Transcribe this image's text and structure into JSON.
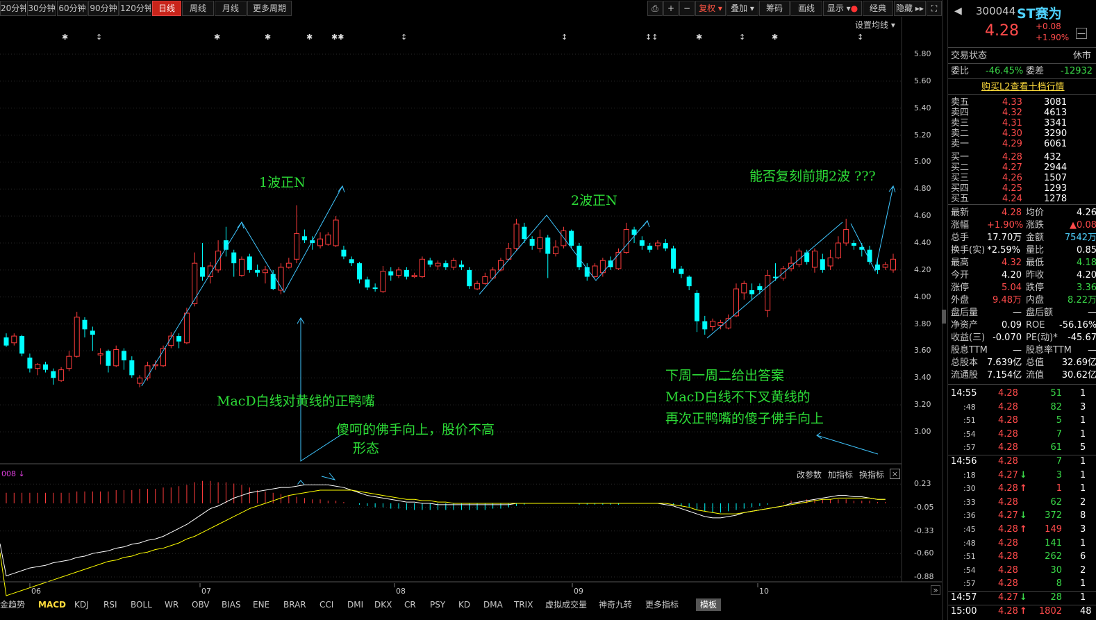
{
  "periods": [
    "20分钟",
    "30分钟",
    "60分钟",
    "90分钟",
    "120分钟",
    "日线",
    "周线",
    "月线",
    "更多周期"
  ],
  "active_period": "日线",
  "tools": [
    "复权",
    "叠加",
    "筹码",
    "画线",
    "显示",
    "经典",
    "隐藏"
  ],
  "settings_label": "设置均线",
  "macd_buttons": [
    "改参数",
    "加指标",
    "换指标"
  ],
  "macd_value": "008",
  "ind_tabs": [
    "金趋势",
    "MACD",
    "KDJ",
    "RSI",
    "BOLL",
    "WR",
    "OBV",
    "BIAS",
    "ENE",
    "BRAR",
    "CCI",
    "DMI",
    "DKX",
    "CR",
    "PSY",
    "KD",
    "DMA",
    "TRIX",
    "虚拟成交量",
    "神奇九转",
    "更多指标",
    "模板"
  ],
  "active_tab": "MACD",
  "price_axis": [
    "5.80",
    "5.60",
    "5.40",
    "5.20",
    "5.00",
    "4.80",
    "4.60",
    "4.40",
    "4.20",
    "4.00",
    "3.80",
    "3.60",
    "3.40",
    "3.20",
    "3.00"
  ],
  "macd_axis": [
    "0.23",
    "-0.05",
    "-0.33",
    "-0.60",
    "-0.88"
  ],
  "months": [
    "06",
    "07",
    "08",
    "09",
    "10"
  ],
  "annotations": {
    "wave1": "1波正N",
    "wave2": "2波正N",
    "question": "能否复刻前期2波 ???",
    "macd_line": "MacD白线对黄线的正鸭嘴",
    "fo1": "傻呵的佛手向上，股价不高",
    "fo2": "形态",
    "ans1": "下周一周二给出答案",
    "ans2": "MacD白线不下叉黄线的",
    "ans3": "再次正鸭嘴的傻子佛手向上"
  },
  "stock": {
    "code": "300044",
    "name": "ST赛为",
    "price": "4.28",
    "change": "+0.08",
    "pct": "+1.90%"
  },
  "status": {
    "label": "交易状态",
    "value": "休市"
  },
  "ratio": {
    "wb_label": "委比",
    "wb": "-46.45%",
    "wc_label": "委差",
    "wc": "-12932"
  },
  "l2_link": "购买L2查看十档行情",
  "asks": [
    [
      "卖五",
      "4.33",
      "3081"
    ],
    [
      "卖四",
      "4.32",
      "4613"
    ],
    [
      "卖三",
      "4.31",
      "3341"
    ],
    [
      "卖二",
      "4.30",
      "3290"
    ],
    [
      "卖一",
      "4.29",
      "6061"
    ]
  ],
  "bids": [
    [
      "买一",
      "4.28",
      "432"
    ],
    [
      "买二",
      "4.27",
      "2944"
    ],
    [
      "买三",
      "4.26",
      "1507"
    ],
    [
      "买四",
      "4.25",
      "1293"
    ],
    [
      "买五",
      "4.24",
      "1278"
    ]
  ],
  "stats": [
    [
      "最新",
      "4.28",
      "均价",
      "4.26"
    ],
    [
      "涨幅",
      "+1.90%",
      "涨跌",
      "▲0.08"
    ],
    [
      "总手",
      "17.70万",
      "金额",
      "7542万"
    ],
    [
      "换手(实)",
      "*2.59%",
      "量比",
      "0.85"
    ],
    [
      "最高",
      "4.32",
      "最低",
      "4.18"
    ],
    [
      "今开",
      "4.20",
      "昨收",
      "4.20"
    ],
    [
      "涨停",
      "5.04",
      "跌停",
      "3.36"
    ],
    [
      "外盘",
      "9.48万",
      "内盘",
      "8.22万"
    ],
    [
      "盘后量",
      "—",
      "盘后额",
      "—"
    ],
    [
      "净资产",
      "0.09",
      "ROE",
      "-56.16%"
    ],
    [
      "收益(三)",
      "-0.070",
      "PE(动)*",
      "-45.67"
    ],
    [
      "股息TTM",
      "—",
      "股息率TTM",
      "—"
    ],
    [
      "总股本",
      "7.639亿",
      "总值",
      "32.69亿"
    ],
    [
      "流通股",
      "7.154亿",
      "流值",
      "30.62亿"
    ]
  ],
  "ticks": [
    [
      "14:55",
      "4.28",
      "51",
      "1",
      ""
    ],
    [
      ":48",
      "4.28",
      "82",
      "3",
      ""
    ],
    [
      ":51",
      "4.28",
      "5",
      "1",
      ""
    ],
    [
      ":54",
      "4.28",
      "7",
      "1",
      ""
    ],
    [
      ":57",
      "4.28",
      "61",
      "5",
      ""
    ],
    [
      "14:56",
      "4.28",
      "7",
      "1",
      ""
    ],
    [
      ":18",
      "4.27",
      "3",
      "1",
      "down"
    ],
    [
      ":30",
      "4.28",
      "1",
      "1",
      "up"
    ],
    [
      ":33",
      "4.28",
      "62",
      "2",
      ""
    ],
    [
      ":36",
      "4.27",
      "372",
      "8",
      "down"
    ],
    [
      ":45",
      "4.28",
      "149",
      "3",
      "up"
    ],
    [
      ":48",
      "4.28",
      "141",
      "1",
      ""
    ],
    [
      ":51",
      "4.28",
      "262",
      "6",
      ""
    ],
    [
      ":54",
      "4.28",
      "30",
      "2",
      ""
    ],
    [
      ":57",
      "4.28",
      "8",
      "1",
      ""
    ],
    [
      "14:57",
      "4.27",
      "28",
      "1",
      "down"
    ],
    [
      "15:00",
      "4.28",
      "1802",
      "48",
      "up"
    ]
  ],
  "chart_data": {
    "type": "candlestick",
    "ylim": [
      2.9,
      5.85
    ],
    "x_months": [
      "06",
      "07",
      "08",
      "09",
      "10"
    ],
    "candles": [
      [
        3.7,
        3.64,
        3.73,
        3.63
      ],
      [
        3.66,
        3.71,
        3.73,
        3.64
      ],
      [
        3.71,
        3.58,
        3.72,
        3.56
      ],
      [
        3.55,
        3.47,
        3.58,
        3.44
      ],
      [
        3.47,
        3.5,
        3.51,
        3.42
      ],
      [
        3.5,
        3.46,
        3.52,
        3.44
      ],
      [
        3.45,
        3.4,
        3.47,
        3.35
      ],
      [
        3.38,
        3.46,
        3.48,
        3.37
      ],
      [
        3.47,
        3.56,
        3.6,
        3.45
      ],
      [
        3.56,
        3.85,
        3.89,
        3.55
      ],
      [
        3.83,
        3.76,
        3.85,
        3.7
      ],
      [
        3.75,
        3.72,
        3.78,
        3.6
      ],
      [
        3.57,
        3.58,
        3.62,
        3.5
      ],
      [
        3.6,
        3.49,
        3.61,
        3.44
      ],
      [
        3.49,
        3.61,
        3.64,
        3.48
      ],
      [
        3.6,
        3.53,
        3.62,
        3.46
      ],
      [
        3.53,
        3.42,
        3.56,
        3.4
      ],
      [
        3.36,
        3.4,
        3.42,
        3.33
      ],
      [
        3.4,
        3.49,
        3.52,
        3.38
      ],
      [
        3.49,
        3.5,
        3.53,
        3.46
      ],
      [
        3.49,
        3.62,
        3.64,
        3.48
      ],
      [
        3.64,
        3.71,
        3.74,
        3.62
      ],
      [
        3.71,
        3.67,
        3.73,
        3.62
      ],
      [
        3.66,
        3.88,
        3.92,
        3.65
      ],
      [
        3.95,
        4.25,
        4.33,
        3.93
      ],
      [
        4.22,
        4.15,
        4.4,
        4.12
      ],
      [
        4.15,
        4.23,
        4.26,
        4.1
      ],
      [
        4.2,
        4.34,
        4.42,
        4.18
      ],
      [
        4.42,
        4.35,
        4.52,
        4.3
      ],
      [
        4.33,
        4.25,
        4.35,
        4.15
      ],
      [
        4.16,
        4.28,
        4.3,
        4.15
      ],
      [
        4.3,
        4.2,
        4.32,
        4.18
      ],
      [
        4.2,
        4.18,
        4.24,
        4.15
      ],
      [
        4.18,
        4.2,
        4.23,
        4.1
      ],
      [
        4.17,
        4.06,
        4.2,
        4.05
      ],
      [
        4.05,
        4.22,
        4.25,
        4.02
      ],
      [
        4.22,
        4.25,
        4.29,
        4.21
      ],
      [
        4.28,
        4.47,
        4.68,
        4.25
      ],
      [
        4.45,
        4.42,
        4.5,
        4.4
      ],
      [
        4.42,
        4.4,
        4.45,
        4.35
      ],
      [
        4.38,
        4.43,
        4.48,
        4.36
      ],
      [
        4.39,
        4.46,
        4.48,
        4.38
      ],
      [
        4.38,
        4.57,
        4.6,
        4.37
      ],
      [
        4.35,
        4.3,
        4.38,
        4.28
      ],
      [
        4.28,
        4.25,
        4.3,
        4.23
      ],
      [
        4.25,
        4.13,
        4.26,
        4.1
      ],
      [
        4.13,
        4.07,
        4.15,
        4.05
      ],
      [
        4.07,
        4.06,
        4.1,
        4.04
      ],
      [
        4.04,
        4.19,
        4.23,
        4.03
      ],
      [
        4.19,
        4.16,
        4.22,
        4.12
      ],
      [
        4.16,
        4.2,
        4.22,
        4.14
      ],
      [
        4.2,
        4.15,
        4.22,
        4.13
      ],
      [
        4.15,
        4.16,
        4.18,
        4.14
      ],
      [
        4.15,
        4.28,
        4.3,
        4.14
      ],
      [
        4.27,
        4.24,
        4.29,
        4.22
      ],
      [
        4.23,
        4.25,
        4.27,
        4.2
      ],
      [
        4.25,
        4.22,
        4.27,
        4.2
      ],
      [
        4.22,
        4.27,
        4.29,
        4.2
      ],
      [
        4.24,
        4.22,
        4.27,
        4.2
      ],
      [
        4.2,
        4.08,
        4.22,
        4.06
      ],
      [
        4.06,
        4.1,
        4.12,
        4.05
      ],
      [
        4.1,
        4.15,
        4.18,
        4.09
      ],
      [
        4.14,
        4.2,
        4.22,
        4.13
      ],
      [
        4.2,
        4.27,
        4.29,
        4.19
      ],
      [
        4.28,
        4.36,
        4.4,
        4.27
      ],
      [
        4.36,
        4.54,
        4.58,
        4.34
      ],
      [
        4.52,
        4.43,
        4.55,
        4.4
      ],
      [
        4.43,
        4.38,
        4.45,
        4.35
      ],
      [
        4.36,
        4.44,
        4.5,
        4.33
      ],
      [
        4.44,
        4.32,
        4.46,
        4.14
      ],
      [
        4.32,
        4.37,
        4.42,
        4.3
      ],
      [
        4.38,
        4.49,
        4.52,
        4.36
      ],
      [
        4.49,
        4.38,
        4.5,
        4.36
      ],
      [
        4.38,
        4.22,
        4.4,
        4.2
      ],
      [
        4.22,
        4.15,
        4.25,
        4.12
      ],
      [
        4.15,
        4.23,
        4.25,
        4.14
      ],
      [
        4.18,
        4.27,
        4.29,
        4.15
      ],
      [
        4.27,
        4.22,
        4.3,
        4.2
      ],
      [
        4.21,
        4.33,
        4.36,
        4.2
      ],
      [
        4.33,
        4.5,
        4.55,
        4.32
      ],
      [
        4.5,
        4.46,
        4.52,
        4.4
      ],
      [
        4.42,
        4.38,
        4.45,
        4.35
      ],
      [
        4.38,
        4.35,
        4.4,
        4.33
      ],
      [
        4.38,
        4.4,
        4.42,
        4.35
      ],
      [
        4.4,
        4.36,
        4.43,
        4.34
      ],
      [
        4.36,
        4.21,
        4.38,
        4.18
      ],
      [
        4.21,
        4.17,
        4.23,
        4.14
      ],
      [
        4.15,
        4.08,
        4.16,
        4.05
      ],
      [
        4.03,
        3.82,
        4.05,
        3.74
      ],
      [
        3.82,
        3.76,
        3.86,
        3.72
      ],
      [
        3.78,
        3.82,
        3.84,
        3.75
      ],
      [
        3.79,
        3.81,
        3.83,
        3.76
      ],
      [
        3.77,
        3.84,
        3.87,
        3.76
      ],
      [
        3.86,
        4.06,
        4.1,
        3.85
      ],
      [
        4.03,
        4.1,
        4.12,
        3.98
      ],
      [
        4.05,
        4.02,
        4.1,
        3.98
      ],
      [
        4.08,
        4.05,
        4.1,
        4.02
      ],
      [
        3.9,
        4.16,
        4.2,
        3.85
      ],
      [
        4.15,
        4.14,
        4.25,
        4.12
      ],
      [
        4.14,
        4.21,
        4.23,
        4.12
      ],
      [
        4.21,
        4.25,
        4.3,
        4.19
      ],
      [
        4.24,
        4.34,
        4.36,
        4.22
      ],
      [
        4.33,
        4.26,
        4.35,
        4.24
      ],
      [
        4.22,
        4.34,
        4.36,
        4.18
      ],
      [
        4.28,
        4.2,
        4.32,
        4.18
      ],
      [
        4.23,
        4.29,
        4.35,
        4.2
      ],
      [
        4.29,
        4.4,
        4.45,
        4.28
      ],
      [
        4.4,
        4.5,
        4.58,
        4.38
      ],
      [
        4.4,
        4.38,
        4.42,
        4.35
      ],
      [
        4.37,
        4.35,
        4.4,
        4.3
      ],
      [
        4.35,
        4.26,
        4.38,
        4.24
      ],
      [
        4.24,
        4.2,
        4.28,
        4.17
      ],
      [
        4.22,
        4.24,
        4.26,
        4.2
      ],
      [
        4.2,
        4.28,
        4.32,
        4.18
      ]
    ],
    "macd_range": [
      -0.9,
      0.3
    ],
    "macd_hist": [
      0.08,
      0.08,
      0.08,
      0.08,
      0.08,
      0.08,
      0.08,
      0.08,
      0.08,
      0.09,
      0.09,
      0.09,
      0.09,
      0.09,
      0.1,
      0.1,
      0.1,
      0.11,
      0.11,
      0.11,
      0.12,
      0.12,
      0.13,
      0.14,
      0.16,
      0.17,
      0.17,
      0.16,
      0.16,
      0.15,
      0.14,
      0.12,
      0.1,
      0.09,
      0.08,
      0.07,
      0.06,
      0.05,
      0.04,
      0.03,
      0.03,
      0.02,
      0.02,
      0.01,
      0.0,
      -0.01,
      -0.02,
      -0.03,
      -0.03,
      -0.04,
      -0.04,
      -0.05,
      -0.05,
      -0.05,
      -0.05,
      -0.05,
      -0.05,
      -0.05,
      -0.05,
      -0.05,
      -0.05,
      -0.05,
      -0.04,
      -0.04,
      -0.03,
      -0.02,
      -0.01,
      0.0,
      0.0,
      0.0,
      0.0,
      0.0,
      0.0,
      -0.01,
      -0.01,
      -0.01,
      -0.01,
      -0.01,
      -0.01,
      0.0,
      0.0,
      0.0,
      0.0,
      0.0,
      0.0,
      -0.01,
      -0.02,
      -0.03,
      -0.05,
      -0.06,
      -0.07,
      -0.07,
      -0.06,
      -0.05,
      -0.04,
      -0.03,
      -0.02,
      -0.01,
      0.0,
      0.01,
      0.02,
      0.02,
      0.03,
      0.03,
      0.03,
      0.03,
      0.03,
      0.03,
      0.02,
      0.02,
      0.02,
      0.01,
      0.01
    ],
    "macd_dif": [
      -0.55,
      -0.53,
      -0.51,
      -0.49,
      -0.48,
      -0.47,
      -0.45,
      -0.44,
      -0.43,
      -0.41,
      -0.4,
      -0.38,
      -0.37,
      -0.36,
      -0.34,
      -0.33,
      -0.31,
      -0.3,
      -0.28,
      -0.27,
      -0.25,
      -0.22,
      -0.19,
      -0.16,
      -0.12,
      -0.08,
      -0.04,
      -0.02,
      0.01,
      0.04,
      0.06,
      0.08,
      0.09,
      0.1,
      0.11,
      0.12,
      0.12,
      0.13,
      0.14,
      0.14,
      0.14,
      0.14,
      0.13,
      0.12,
      0.1,
      0.08,
      0.06,
      0.05,
      0.04,
      0.03,
      0.02,
      0.01,
      0.01,
      0.0,
      0.0,
      -0.01,
      -0.01,
      -0.01,
      -0.01,
      -0.01,
      -0.01,
      -0.01,
      -0.01,
      -0.01,
      -0.01,
      0.0,
      0.0,
      0.0,
      0.0,
      0.0,
      0.0,
      0.0,
      0.0,
      0.0,
      0.0,
      0.0,
      0.0,
      0.0,
      0.0,
      0.0,
      0.0,
      0.0,
      0.0,
      0.0,
      -0.01,
      -0.02,
      -0.04,
      -0.06,
      -0.08,
      -0.1,
      -0.11,
      -0.11,
      -0.1,
      -0.09,
      -0.07,
      -0.06,
      -0.05,
      -0.04,
      -0.03,
      -0.02,
      0.0,
      0.01,
      0.02,
      0.03,
      0.04,
      0.05,
      0.06,
      0.06,
      0.05,
      0.05,
      0.04,
      0.03,
      0.03
    ],
    "macd_dea": [
      -0.7,
      -0.68,
      -0.66,
      -0.64,
      -0.62,
      -0.6,
      -0.58,
      -0.56,
      -0.54,
      -0.52,
      -0.5,
      -0.48,
      -0.46,
      -0.44,
      -0.43,
      -0.41,
      -0.4,
      -0.38,
      -0.37,
      -0.35,
      -0.34,
      -0.32,
      -0.3,
      -0.27,
      -0.25,
      -0.22,
      -0.19,
      -0.16,
      -0.13,
      -0.1,
      -0.07,
      -0.04,
      -0.02,
      0.0,
      0.02,
      0.04,
      0.06,
      0.07,
      0.08,
      0.09,
      0.1,
      0.1,
      0.1,
      0.1,
      0.1,
      0.09,
      0.08,
      0.07,
      0.06,
      0.05,
      0.04,
      0.03,
      0.03,
      0.02,
      0.02,
      0.01,
      0.01,
      0.0,
      0.0,
      0.0,
      0.0,
      0.0,
      0.0,
      0.0,
      0.0,
      0.0,
      0.0,
      0.0,
      0.0,
      0.0,
      0.0,
      0.0,
      0.0,
      0.0,
      0.0,
      0.0,
      0.0,
      0.0,
      0.0,
      0.0,
      0.0,
      0.0,
      0.0,
      0.0,
      0.0,
      -0.01,
      -0.02,
      -0.03,
      -0.05,
      -0.06,
      -0.07,
      -0.08,
      -0.08,
      -0.08,
      -0.07,
      -0.06,
      -0.05,
      -0.04,
      -0.03,
      -0.02,
      -0.01,
      0.0,
      0.01,
      0.02,
      0.03,
      0.03,
      0.04,
      0.04,
      0.04,
      0.04,
      0.04,
      0.03,
      0.03
    ]
  }
}
